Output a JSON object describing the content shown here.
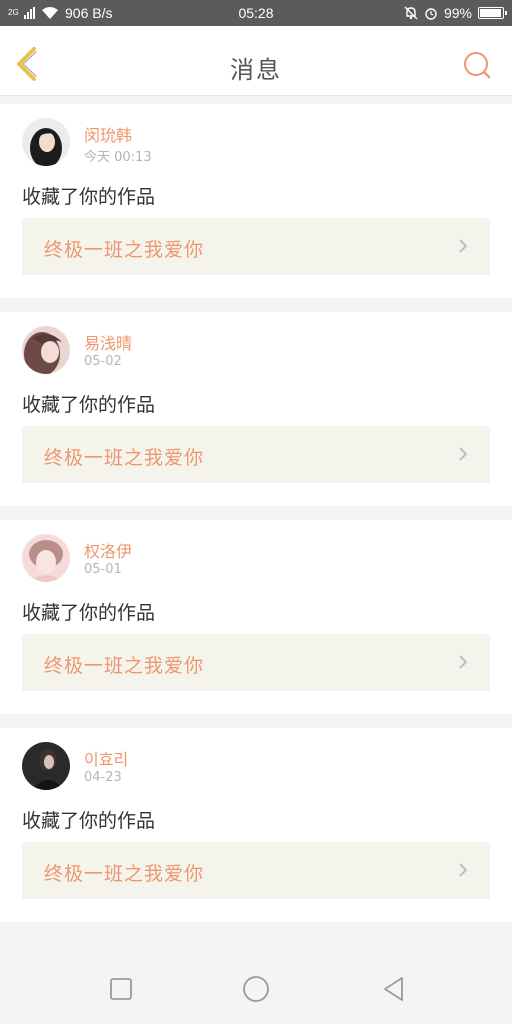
{
  "status_bar": {
    "network_type": "2G",
    "speed": "906 B/s",
    "time": "05:28",
    "battery": "99%",
    "battery_level": 0.99,
    "icons": [
      "signal-icon",
      "wifi-icon",
      "mute-icon",
      "alarm-icon",
      "battery-icon"
    ]
  },
  "header": {
    "title": "消息",
    "back_icon": "chevron-left-icon",
    "search_icon": "search-icon",
    "accent_color": "#f0966e",
    "back_color": "#e8c24a"
  },
  "messages": [
    {
      "user": "闵玧韩",
      "time": "今天 00:13",
      "action": "收藏了你的作品",
      "work_title": "终极一班之我爱你",
      "avatar": "avatar-photo"
    },
    {
      "user": "易浅晴",
      "time": "05-02",
      "action": "收藏了你的作品",
      "work_title": "终极一班之我爱你",
      "avatar": "avatar-photo"
    },
    {
      "user": "权洛伊",
      "time": "05-01",
      "action": "收藏了你的作品",
      "work_title": "终极一班之我爱你",
      "avatar": "avatar-photo"
    },
    {
      "user": "이효리",
      "time": "04-23",
      "action": "收藏了你的作品",
      "work_title": "终极一班之我爱你",
      "avatar": "avatar-photo"
    }
  ],
  "nav_bar": {
    "icons": [
      "recent-apps-icon",
      "home-icon",
      "back-icon"
    ]
  }
}
